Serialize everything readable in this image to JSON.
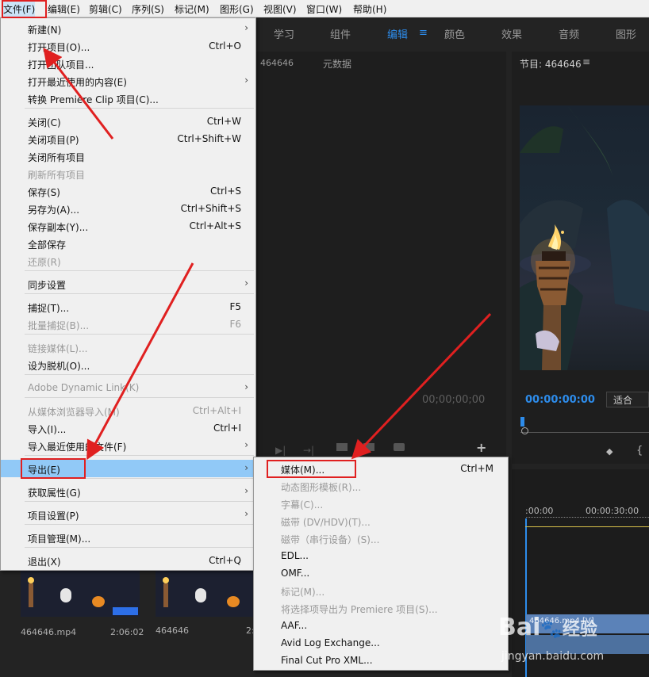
{
  "menubar": {
    "items": [
      "文件(F)",
      "编辑(E)",
      "剪辑(C)",
      "序列(S)",
      "标记(M)",
      "图形(G)",
      "视图(V)",
      "窗口(W)",
      "帮助(H)"
    ]
  },
  "workspaces": {
    "tabs": [
      "学习",
      "组件",
      "编辑",
      "颜色",
      "效果",
      "音频",
      "图形"
    ],
    "active": "编辑"
  },
  "source_panel": {
    "name": "464646",
    "metadata_tab": "元数据",
    "timecode": "00;00;00;00"
  },
  "program_monitor": {
    "title": "节目: 464646",
    "timecode": "00:00:00:00",
    "fit": "适合"
  },
  "timeline": {
    "ruler_start": ":00:00",
    "ruler_mark": "00:00:30:00",
    "clip_label": "464646.mp4 [V]"
  },
  "project_bin": {
    "clip1_name": "464646.mp4",
    "clip1_duration": "2:06:02",
    "clip2_name": "464646",
    "clip2_duration": "2:"
  },
  "file_menu": {
    "items": [
      {
        "label": "新建(N)",
        "shortcut": "",
        "submenu": true,
        "disabled": false
      },
      {
        "label": "打开项目(O)...",
        "shortcut": "Ctrl+O",
        "submenu": false,
        "disabled": false
      },
      {
        "label": "打开团队项目...",
        "shortcut": "",
        "submenu": false,
        "disabled": false
      },
      {
        "label": "打开最近使用的内容(E)",
        "shortcut": "",
        "submenu": true,
        "disabled": false
      },
      {
        "label": "转换 Premiere Clip 项目(C)...",
        "shortcut": "",
        "submenu": false,
        "disabled": false
      },
      {
        "label": "关闭(C)",
        "shortcut": "Ctrl+W",
        "submenu": false,
        "disabled": false
      },
      {
        "label": "关闭项目(P)",
        "shortcut": "Ctrl+Shift+W",
        "submenu": false,
        "disabled": false
      },
      {
        "label": "关闭所有项目",
        "shortcut": "",
        "submenu": false,
        "disabled": false
      },
      {
        "label": "刷新所有项目",
        "shortcut": "",
        "submenu": false,
        "disabled": true
      },
      {
        "label": "保存(S)",
        "shortcut": "Ctrl+S",
        "submenu": false,
        "disabled": false
      },
      {
        "label": "另存为(A)...",
        "shortcut": "Ctrl+Shift+S",
        "submenu": false,
        "disabled": false
      },
      {
        "label": "保存副本(Y)...",
        "shortcut": "Ctrl+Alt+S",
        "submenu": false,
        "disabled": false
      },
      {
        "label": "全部保存",
        "shortcut": "",
        "submenu": false,
        "disabled": false
      },
      {
        "label": "还原(R)",
        "shortcut": "",
        "submenu": false,
        "disabled": true
      },
      {
        "label": "同步设置",
        "shortcut": "",
        "submenu": true,
        "disabled": false
      },
      {
        "label": "捕捉(T)...",
        "shortcut": "F5",
        "submenu": false,
        "disabled": false
      },
      {
        "label": "批量捕捉(B)...",
        "shortcut": "F6",
        "submenu": false,
        "disabled": true
      },
      {
        "label": "链接媒体(L)...",
        "shortcut": "",
        "submenu": false,
        "disabled": true
      },
      {
        "label": "设为脱机(O)...",
        "shortcut": "",
        "submenu": false,
        "disabled": false
      },
      {
        "label": "Adobe Dynamic Link(K)",
        "shortcut": "",
        "submenu": true,
        "disabled": true
      },
      {
        "label": "从媒体浏览器导入(M)",
        "shortcut": "Ctrl+Alt+I",
        "submenu": false,
        "disabled": true
      },
      {
        "label": "导入(I)...",
        "shortcut": "Ctrl+I",
        "submenu": false,
        "disabled": false
      },
      {
        "label": "导入最近使用的文件(F)",
        "shortcut": "",
        "submenu": true,
        "disabled": false
      },
      {
        "label": "导出(E)",
        "shortcut": "",
        "submenu": true,
        "disabled": false
      },
      {
        "label": "获取属性(G)",
        "shortcut": "",
        "submenu": true,
        "disabled": false
      },
      {
        "label": "项目设置(P)",
        "shortcut": "",
        "submenu": true,
        "disabled": false
      },
      {
        "label": "项目管理(M)...",
        "shortcut": "",
        "submenu": false,
        "disabled": false
      },
      {
        "label": "退出(X)",
        "shortcut": "Ctrl+Q",
        "submenu": false,
        "disabled": false
      }
    ]
  },
  "export_menu": {
    "items": [
      {
        "label": "媒体(M)...",
        "shortcut": "Ctrl+M",
        "disabled": false
      },
      {
        "label": "动态图形模板(R)...",
        "shortcut": "",
        "disabled": true
      },
      {
        "label": "字幕(C)...",
        "shortcut": "",
        "disabled": true
      },
      {
        "label": "磁带 (DV/HDV)(T)...",
        "shortcut": "",
        "disabled": true
      },
      {
        "label": "磁带（串行设备）(S)...",
        "shortcut": "",
        "disabled": true
      },
      {
        "label": "EDL...",
        "shortcut": "",
        "disabled": false
      },
      {
        "label": "OMF...",
        "shortcut": "",
        "disabled": false
      },
      {
        "label": "标记(M)...",
        "shortcut": "",
        "disabled": true
      },
      {
        "label": "将选择项导出为 Premiere 项目(S)...",
        "shortcut": "",
        "disabled": true
      },
      {
        "label": "AAF...",
        "shortcut": "",
        "disabled": false
      },
      {
        "label": "Avid Log Exchange...",
        "shortcut": "",
        "disabled": false
      },
      {
        "label": "Final Cut Pro XML...",
        "shortcut": "",
        "disabled": false
      }
    ]
  },
  "watermark": {
    "brand": "Bai",
    "brand2": "经验",
    "url": "jingyan.baidu.com"
  },
  "colors": {
    "accent": "#2d8ceb",
    "annotation": "#e02020",
    "highlight": "#91c9f7"
  }
}
